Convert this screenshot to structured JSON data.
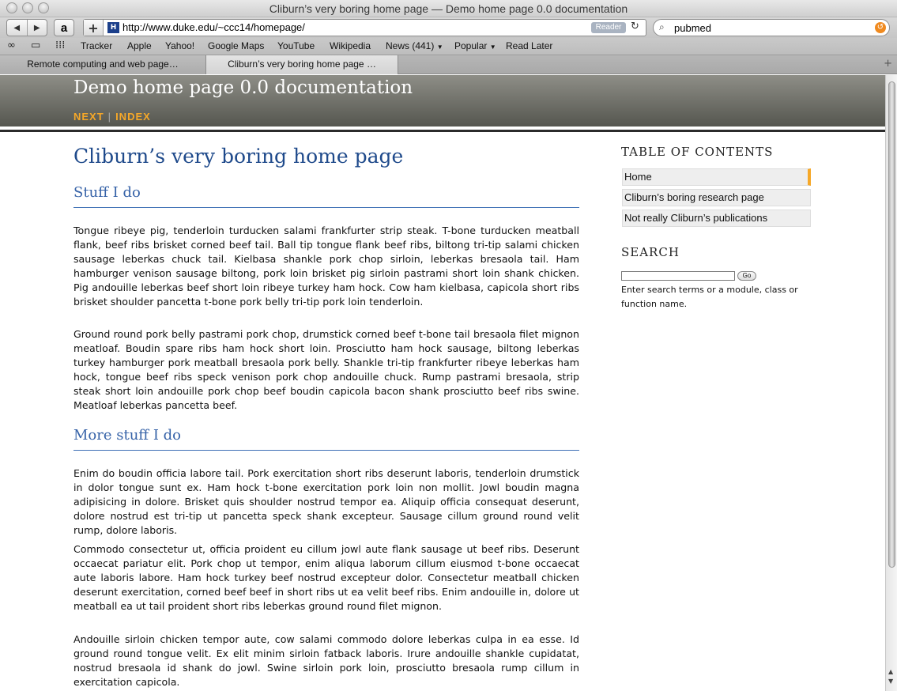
{
  "window": {
    "title": "Cliburn’s very boring home page — Demo home page 0.0 documentation"
  },
  "toolbar": {
    "url": "http://www.duke.edu/~ccc14/homepage/",
    "reader_label": "Reader",
    "search_value": "pubmed"
  },
  "bookmarks": [
    "Tracker",
    "Apple",
    "Yahoo!",
    "Google Maps",
    "YouTube",
    "Wikipedia",
    "News (441)",
    "Popular",
    "Read Later"
  ],
  "tabs": [
    "Remote computing and web page…",
    "Cliburn’s very boring home page …"
  ],
  "header": {
    "site_title": "Demo home page 0.0 documentation",
    "nav_next": "NEXT",
    "nav_index": "INDEX",
    "nav_sep": "|"
  },
  "main": {
    "title": "Cliburn’s very boring home page",
    "section1_title": "Stuff I do",
    "section1_p1": "Tongue ribeye pig, tenderloin turducken salami frankfurter strip steak. T-bone turducken meatball flank, beef ribs brisket corned beef tail. Ball tip tongue flank beef ribs, biltong tri-tip salami chicken sausage leberkas chuck tail. Kielbasa shankle pork chop sirloin, leberkas bresaola tail. Ham hamburger venison sausage biltong, pork loin brisket pig sirloin pastrami short loin shank chicken. Pig andouille leberkas beef short loin ribeye turkey ham hock. Cow ham kielbasa, capicola short ribs brisket shoulder pancetta t-bone pork belly tri-tip pork loin tenderloin.",
    "section1_p2": "Ground round pork belly pastrami pork chop, drumstick corned beef t-bone tail bresaola filet mignon meatloaf. Boudin spare ribs ham hock short loin. Prosciutto ham hock sausage, biltong leberkas turkey hamburger pork meatball bresaola pork belly. Shankle tri-tip frankfurter ribeye leberkas ham hock, tongue beef ribs speck venison pork chop andouille chuck. Rump pastrami bresaola, strip steak short loin andouille pork chop beef boudin capicola bacon shank prosciutto beef ribs swine. Meatloaf leberkas pancetta beef.",
    "section2_title": "More stuff I do",
    "section2_p1": "Enim do boudin officia labore tail. Pork exercitation short ribs deserunt laboris, tenderloin drumstick in dolor tongue sunt ex. Ham hock t-bone exercitation pork loin non mollit. Jowl boudin magna adipisicing in dolore. Brisket quis shoulder nostrud tempor ea. Aliquip officia consequat deserunt, dolore nostrud est tri-tip ut pancetta speck shank excepteur. Sausage cillum ground round velit rump, dolore laboris.",
    "section2_p2": "Commodo consectetur ut, officia proident eu cillum jowl aute flank sausage ut beef ribs. Deserunt occaecat pariatur elit. Pork chop ut tempor, enim aliqua laborum cillum eiusmod t-bone occaecat aute laboris labore. Ham hock turkey beef nostrud excepteur dolor. Consectetur meatball chicken deserunt exercitation, corned beef beef in short ribs ut ea velit beef ribs. Enim andouille in, dolore ut meatball ea ut tail proident short ribs leberkas ground round filet mignon.",
    "section2_p3": "Andouille sirloin chicken tempor aute, cow salami commodo dolore leberkas culpa in ea esse. Id ground round tongue velit. Ex elit minim sirloin fatback laboris. Irure andouille shankle cupidatat, nostrud bresaola id shank do jowl. Swine sirloin pork loin, prosciutto bresaola rump cillum in exercitation capicola."
  },
  "sidebar": {
    "toc_title": "TABLE OF CONTENTS",
    "toc_items": [
      "Home",
      "Cliburn’s boring research page",
      "Not really Cliburn’s publications"
    ],
    "search_title": "SEARCH",
    "go_label": "Go",
    "search_help": "Enter search terms or a module, class or function name."
  },
  "colors": {
    "accent": "#f6a828",
    "heading": "#1f4a8b",
    "header_bg": "#55564f"
  },
  "icons": [
    "back-icon",
    "forward-icon",
    "amazon-icon",
    "add-bookmark-icon",
    "reload-icon",
    "search-icon",
    "clear-icon",
    "reading-list-icon",
    "bookmarks-icon",
    "top-sites-icon",
    "new-tab-icon"
  ]
}
